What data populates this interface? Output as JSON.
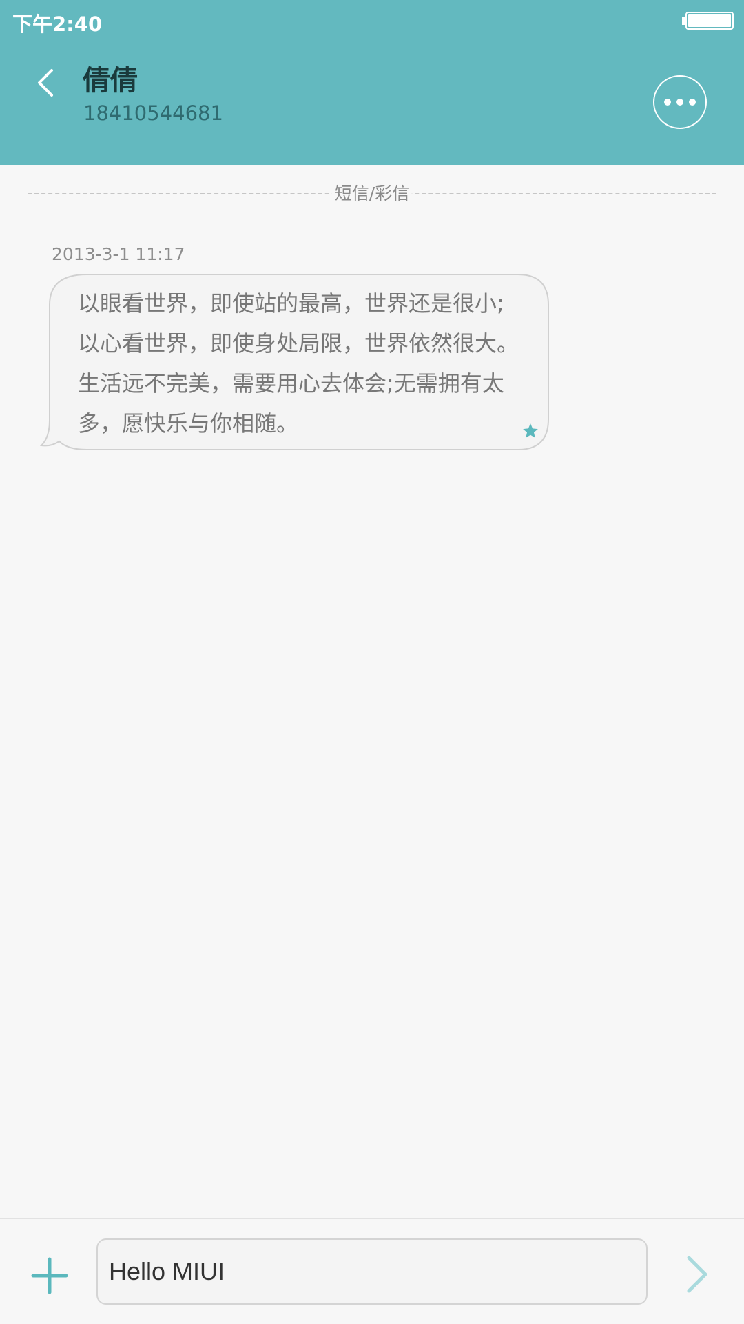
{
  "status_bar": {
    "time": "下午2:40",
    "battery_icon": "battery-icon"
  },
  "header": {
    "back_icon": "chevron-left-icon",
    "contact_name": "倩倩",
    "contact_number": "18410544681",
    "more_icon": "more-dots-icon"
  },
  "divider": {
    "label": "短信/彩信"
  },
  "messages": [
    {
      "time": "2013-3-1 11:17",
      "text": "以眼看世界，即使站的最高，世界还是很小;以心看世界，即使身处局限，世界依然很大。生活远不完美，需要用心去体会;无需拥有太多，愿快乐与你相随。",
      "starred_icon": "star-icon"
    }
  ],
  "composer": {
    "add_icon": "plus-icon",
    "input_value": "Hello MIUI",
    "send_icon": "send-arrow-icon"
  },
  "colors": {
    "header_bg": "#63b9bf",
    "accent": "#5bb8bd",
    "background": "#f7f7f7"
  }
}
